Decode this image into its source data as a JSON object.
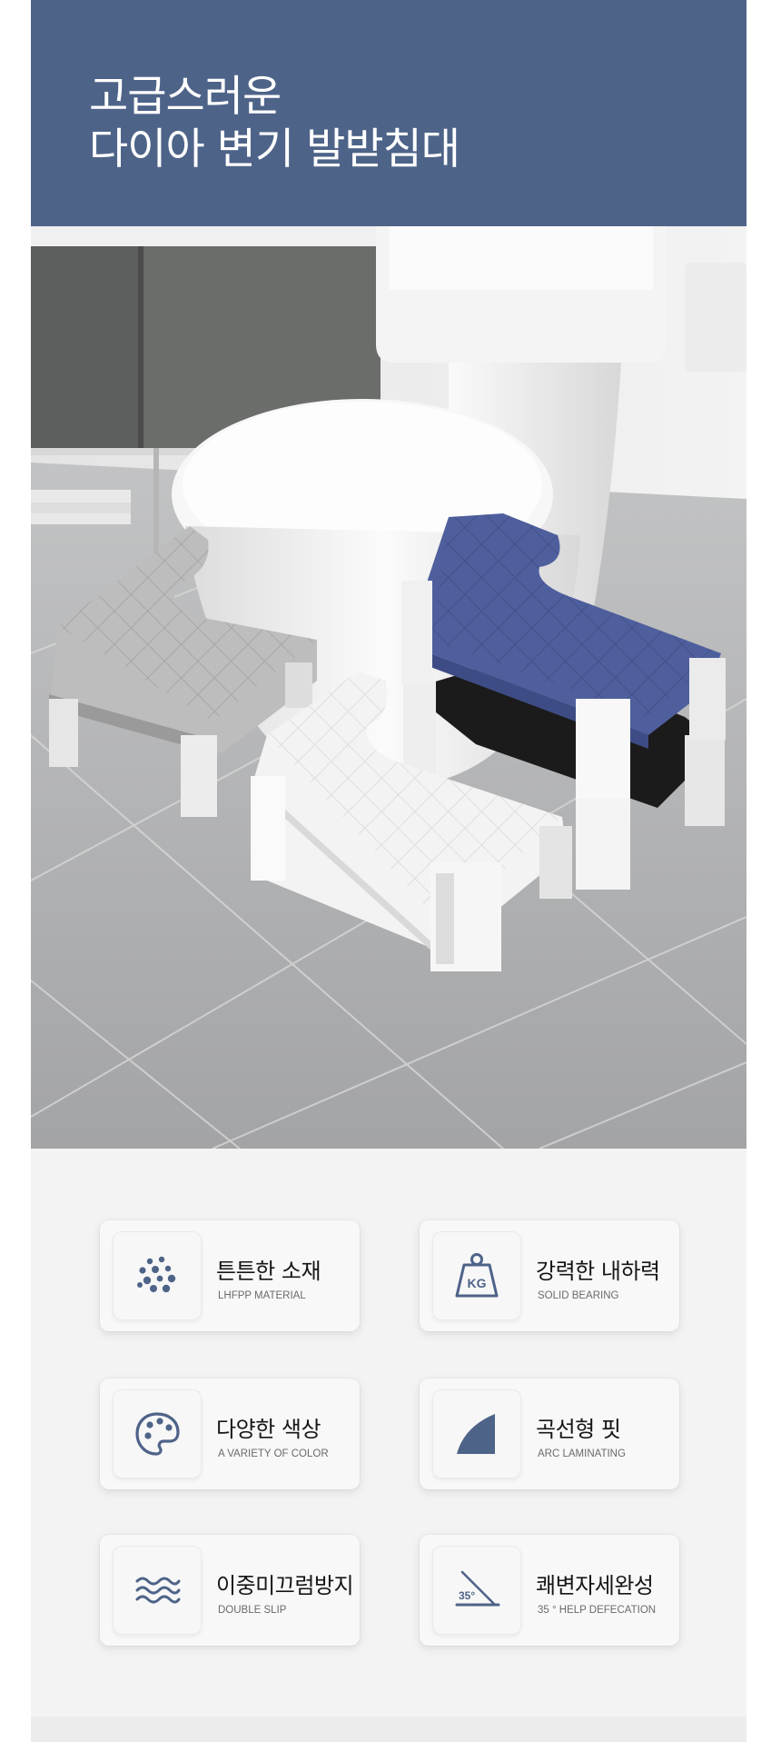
{
  "header": {
    "title_line1": "고급스러운",
    "title_line2": "다이아 변기 발받침대"
  },
  "colors": {
    "header_bg": "#4e6388",
    "accent": "#4e6388",
    "stool_blue": "#4f5f9d",
    "stool_gray": "#b9b9b9",
    "stool_white": "#f2f2f2",
    "stool_black": "#1e1e1e"
  },
  "features": [
    {
      "icon": "dots-icon",
      "title": "튼튼한 소재",
      "subtitle": "LHFPP MATERIAL"
    },
    {
      "icon": "weight-kg-icon",
      "icon_text": "KG",
      "title": "강력한 내하력",
      "subtitle": "SOLID BEARING"
    },
    {
      "icon": "palette-icon",
      "title": "다양한 색상",
      "subtitle": "A VARIETY OF COLOR"
    },
    {
      "icon": "arc-icon",
      "title": "곡선형 핏",
      "subtitle": "ARC LAMINATING"
    },
    {
      "icon": "waves-icon",
      "title": "이중미끄럼방지",
      "subtitle": "DOUBLE SLIP"
    },
    {
      "icon": "angle-icon",
      "icon_text": "35°",
      "title": "쾌변자세완성",
      "subtitle": "35 ° HELP DEFECATION"
    }
  ]
}
